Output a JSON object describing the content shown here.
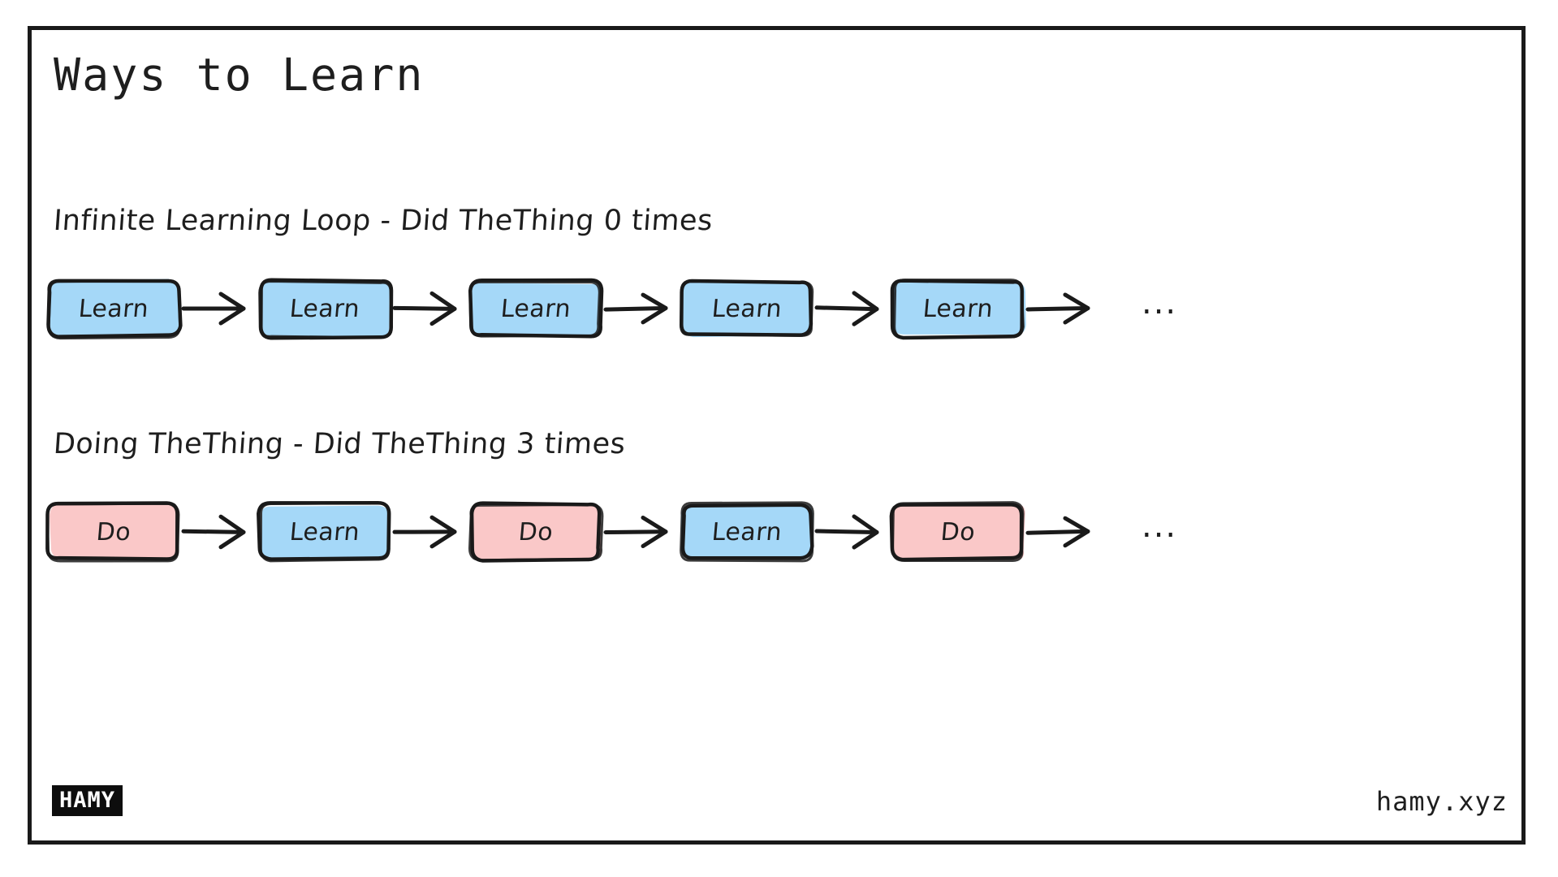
{
  "title": "Ways to Learn",
  "colors": {
    "learn_fill": "#a5d8f8",
    "do_fill": "#fac8c8",
    "stroke": "#1a1a1a",
    "text": "#1e1e1e",
    "frame": "#1a1a1a",
    "background": "#ffffff"
  },
  "rows": [
    {
      "label": "Infinite Learning Loop - Did TheThing 0 times",
      "nodes": [
        {
          "label": "Learn",
          "kind": "learn"
        },
        {
          "label": "Learn",
          "kind": "learn"
        },
        {
          "label": "Learn",
          "kind": "learn"
        },
        {
          "label": "Learn",
          "kind": "learn"
        },
        {
          "label": "Learn",
          "kind": "learn"
        }
      ],
      "trailing": "..."
    },
    {
      "label": "Doing TheThing - Did TheThing 3 times",
      "nodes": [
        {
          "label": "Do",
          "kind": "do"
        },
        {
          "label": "Learn",
          "kind": "learn"
        },
        {
          "label": "Do",
          "kind": "do"
        },
        {
          "label": "Learn",
          "kind": "learn"
        },
        {
          "label": "Do",
          "kind": "do"
        }
      ],
      "trailing": "..."
    }
  ],
  "footer": {
    "logo_text": "HAMY",
    "site": "hamy.xyz"
  }
}
